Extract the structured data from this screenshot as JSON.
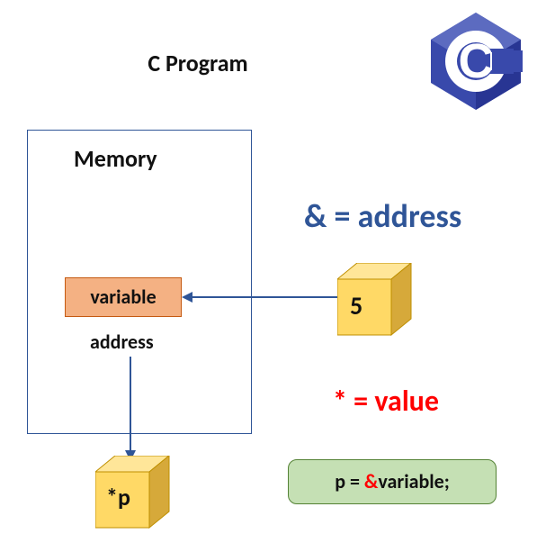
{
  "title": "C Program",
  "logo": {
    "letter": "C"
  },
  "memory": {
    "heading": "Memory",
    "variable_label": "variable",
    "address_label": "address"
  },
  "value_cube": {
    "text": "5"
  },
  "pointer_cube": {
    "text": "*p"
  },
  "legend": {
    "amp": "& = address",
    "star": "* = value"
  },
  "code": {
    "prefix": "p = ",
    "amp": "&",
    "suffix": "variable;"
  },
  "colors": {
    "blue": "#2f5597",
    "red": "#ff0000",
    "orange_fill": "#f4b183",
    "orange_border": "#c55a11",
    "green_fill": "#c5e0b4",
    "green_border": "#548235",
    "cube_front": "#ffd966",
    "cube_top": "#ffe699",
    "cube_side": "#d6a93a",
    "logo_dark": "#283593",
    "logo_mid": "#3949ab",
    "logo_light": "#5c6bc0"
  }
}
